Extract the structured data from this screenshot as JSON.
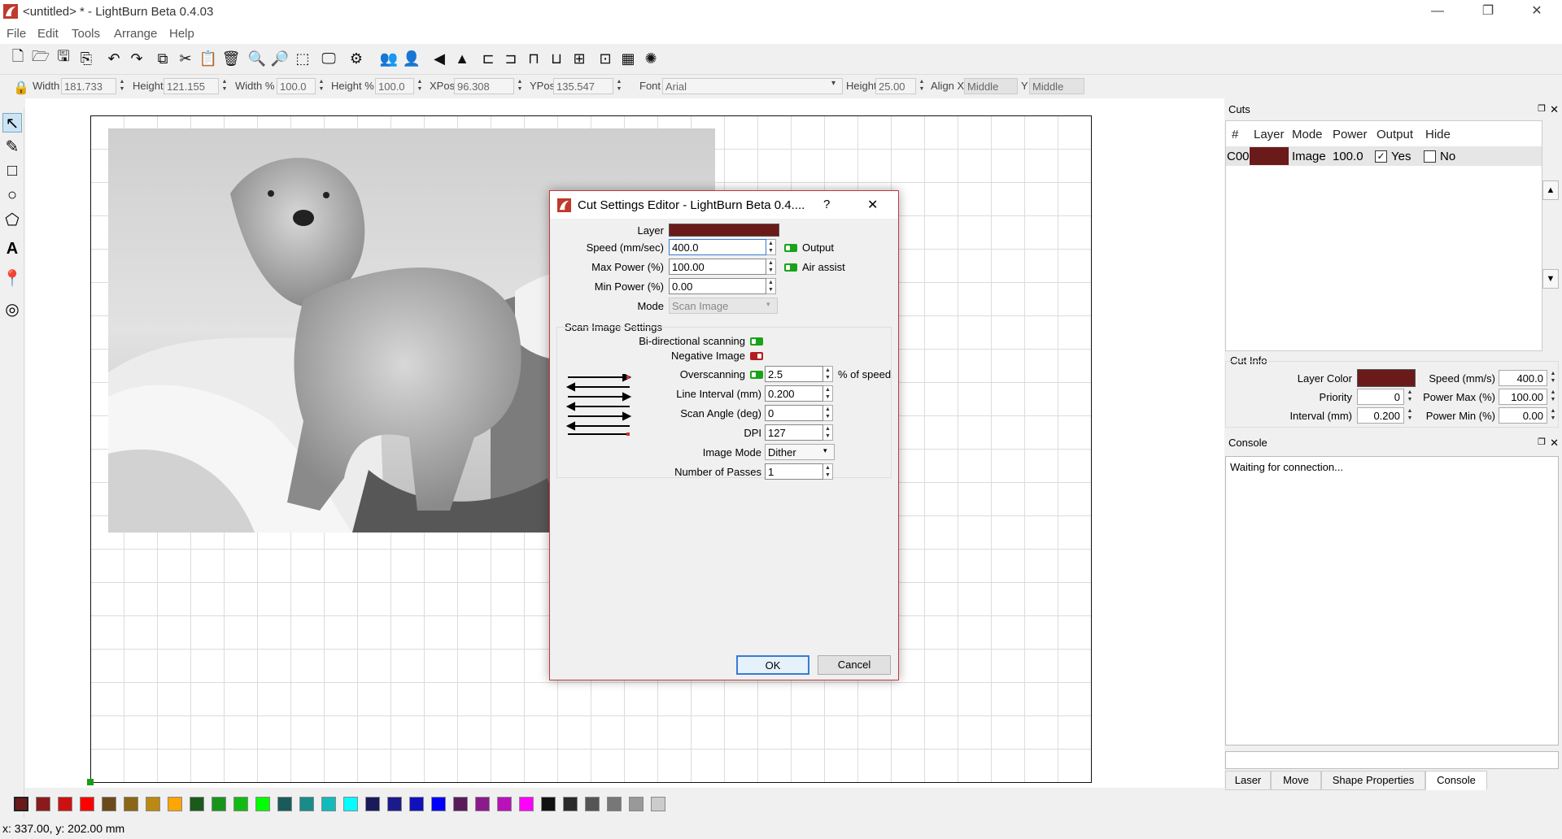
{
  "window": {
    "title": "<untitled> * - LightBurn Beta 0.4.03",
    "minimize": "—",
    "maximize": "❐",
    "close": "✕"
  },
  "menu": [
    "File",
    "Edit",
    "Tools",
    "Arrange",
    "Help"
  ],
  "toolbar2": {
    "width_label": "Width",
    "width_value": "181.733",
    "height_label": "Height",
    "height_value": "121.155",
    "widthpct_label": "Width %",
    "widthpct_value": "100.0",
    "heightpct_label": "Height %",
    "heightpct_value": "100.0",
    "xpos_label": "XPos",
    "xpos_value": "96.308",
    "ypos_label": "YPos",
    "ypos_value": "135.547",
    "font_label": "Font",
    "font_value": "Arial",
    "fheight_label": "Height",
    "fheight_value": "25.00",
    "alignx_label": "Align X",
    "alignx_value": "Middle",
    "aligny_label": "Y",
    "aligny_value": "Middle"
  },
  "palette_colors": [
    "#6b1a1a",
    "#8b1a1a",
    "#cc1111",
    "#ff0000",
    "#6b4a1a",
    "#8b6614",
    "#bb8811",
    "#ffa500",
    "#1a5a1a",
    "#18941c",
    "#11bb11",
    "#00ff00",
    "#1a5a5a",
    "#1a8b8b",
    "#11bbbb",
    "#00ffff",
    "#1a1a5a",
    "#1a1a8b",
    "#1111bb",
    "#0000ff",
    "#5a1a5a",
    "#8b1a8b",
    "#bb11bb",
    "#ff00ff",
    "#111111",
    "#2a2a2a",
    "#555555",
    "#777777",
    "#999999",
    "#cccccc"
  ],
  "status": {
    "coords": "x: 337.00, y: 202.00 mm"
  },
  "cuts": {
    "title": "Cuts",
    "headers": [
      "#",
      "Layer",
      "Mode",
      "Power",
      "Output",
      "Hide"
    ],
    "row": {
      "id": "C00",
      "color": "#6b1a1a",
      "mode": "Image",
      "power": "100.0",
      "output": "Yes",
      "output_checked": true,
      "hide": "No",
      "hide_checked": false
    }
  },
  "cut_info": {
    "title": "Cut Info",
    "layer_color_label": "Layer Color",
    "layer_color": "#6b1a1a",
    "speed_label": "Speed  (mm/s)",
    "speed_value": "400.0",
    "priority_label": "Priority",
    "priority_value": "0",
    "power_max_label": "Power Max (%)",
    "power_max_value": "100.00",
    "interval_label": "Interval (mm)",
    "interval_value": "0.200",
    "power_min_label": "Power Min (%)",
    "power_min_value": "0.00"
  },
  "console": {
    "title": "Console",
    "text": "Waiting for connection..."
  },
  "bottom_tabs": [
    "Laser",
    "Move",
    "Shape Properties",
    "Console"
  ],
  "dialog": {
    "title": "Cut Settings Editor - LightBurn Beta 0.4....",
    "help": "?",
    "close": "✕",
    "layer_label": "Layer",
    "layer_color": "#6b1a1a",
    "speed_label": "Speed (mm/sec)",
    "speed_value": "400.0",
    "max_power_label": "Max Power (%)",
    "max_power_value": "100.00",
    "min_power_label": "Min Power (%)",
    "min_power_value": "0.00",
    "mode_label": "Mode",
    "mode_value": "Scan Image",
    "output_label": "Output",
    "air_assist_label": "Air assist",
    "scan_section": "Scan Image Settings",
    "bidir_label": "Bi-directional scanning",
    "negative_label": "Negative Image",
    "overscan_label": "Overscanning",
    "overscan_value": "2.5",
    "overscan_unit": "% of speed",
    "line_interval_label": "Line Interval (mm)",
    "line_interval_value": "0.200",
    "scan_angle_label": "Scan Angle (deg)",
    "scan_angle_value": "0",
    "dpi_label": "DPI",
    "dpi_value": "127",
    "image_mode_label": "Image Mode",
    "image_mode_value": "Dither",
    "passes_label": "Number of Passes",
    "passes_value": "1",
    "ok": "OK",
    "cancel": "Cancel"
  }
}
